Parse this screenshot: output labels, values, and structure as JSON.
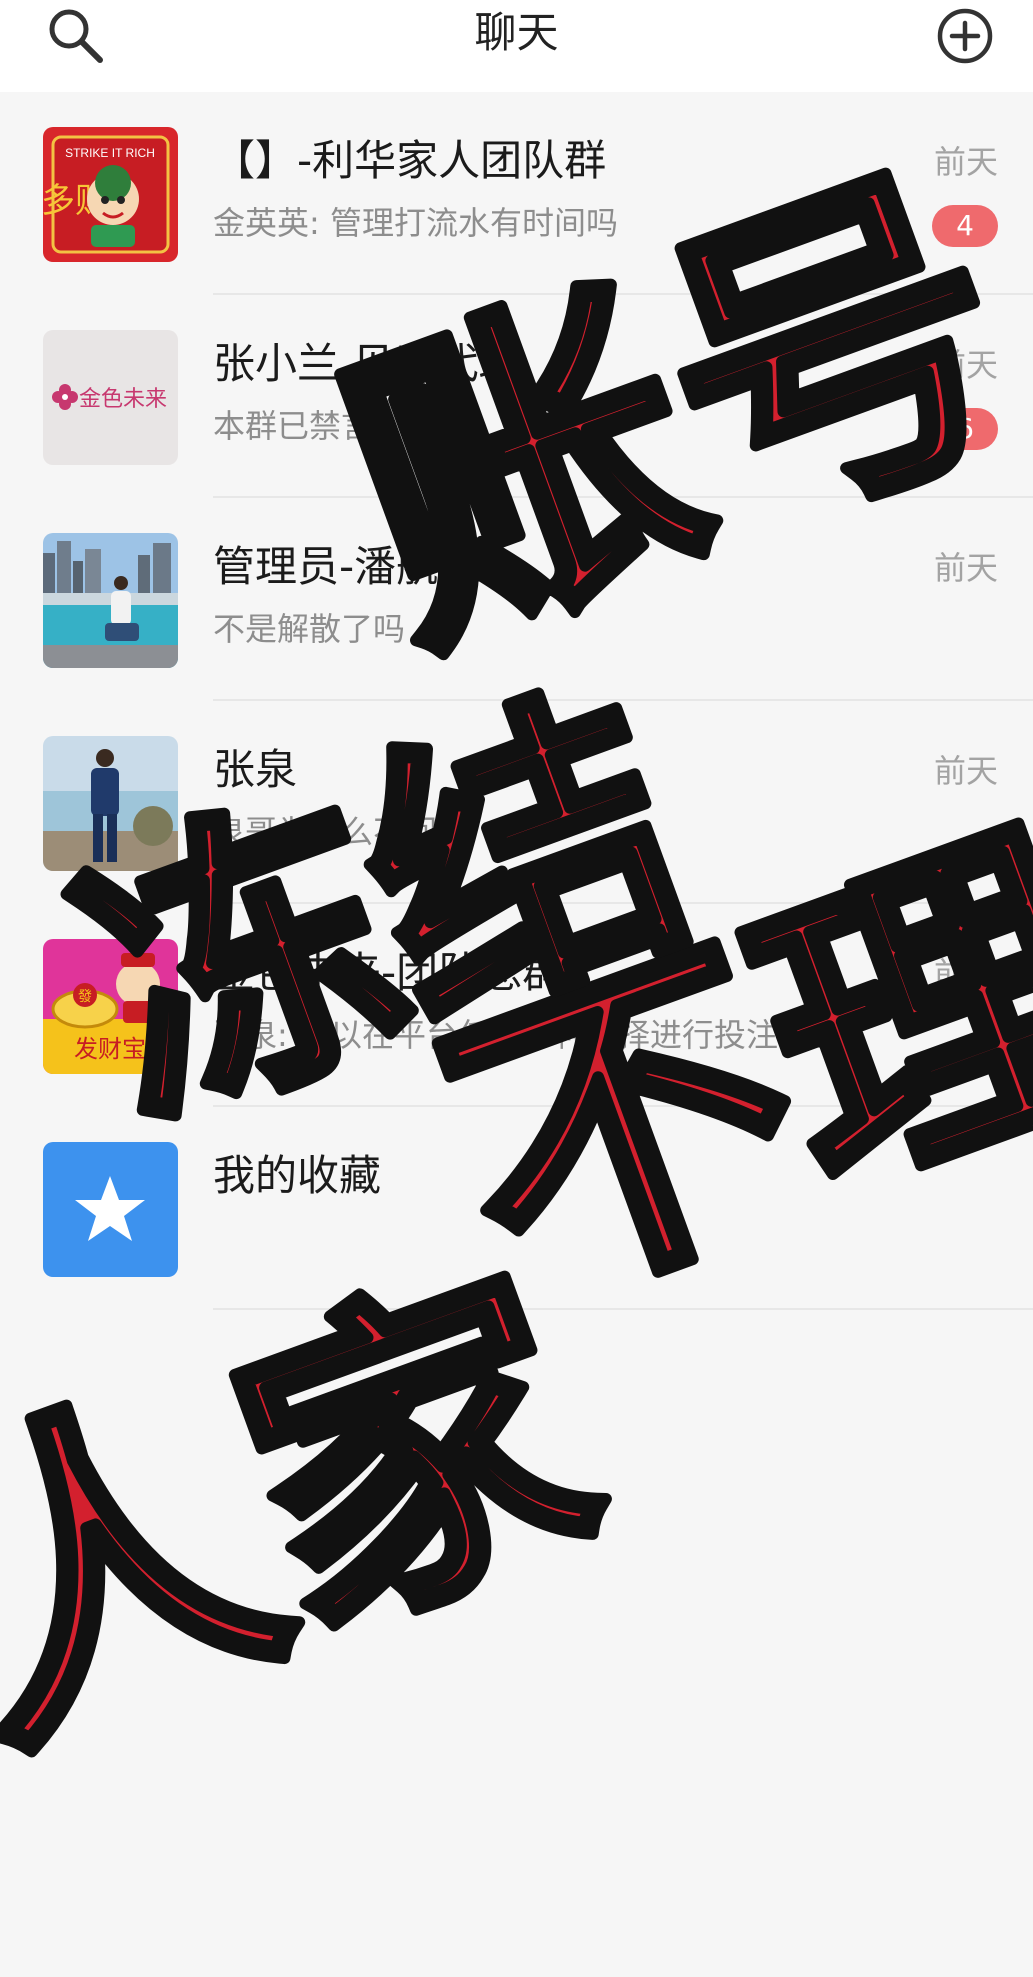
{
  "header": {
    "title": "聊天",
    "left_icon": "search-icon",
    "right_icon": "add-circle-icon"
  },
  "chats": [
    {
      "name": "【】-利华家人团队群",
      "preview": "金英英: 管理打流水有时间吗",
      "time": "前天",
      "badge": "4",
      "avatar": "fortune-god-avatar",
      "avatar_text": [
        "STRIKE IT RICH",
        "多财"
      ]
    },
    {
      "name": "张小兰 见习代理",
      "preview": "本群已禁言",
      "time": "前天",
      "badge": "6",
      "avatar": "brand-logo-avatar",
      "avatar_text": [
        "金色未来"
      ]
    },
    {
      "name": "管理员-潘航",
      "preview": "不是解散了吗",
      "time": "前天",
      "badge": "",
      "avatar": "photo-avatar-waterfront"
    },
    {
      "name": "张泉",
      "preview": "泉哥为什么不回复",
      "time": "前天",
      "badge": "",
      "avatar": "photo-avatar-man-suit"
    },
    {
      "name": "金色未来-团队总群",
      "preview": "张泉: 可以在平台任意彩种选择进行投注",
      "time": "前天",
      "badge": "",
      "avatar": "treasure-avatar",
      "avatar_text": [
        "发财宝",
        "發"
      ]
    },
    {
      "name": "我的收藏",
      "preview": "",
      "time": "",
      "badge": "",
      "avatar": "star-icon"
    }
  ],
  "overlay": {
    "text": [
      "账号",
      "不理",
      "冻结",
      "人家"
    ],
    "fill_color": "#d3202e",
    "stroke_color": "#111111"
  },
  "colors": {
    "badge": "#ef6a6d",
    "time": "#a3a3a3",
    "preview": "#8d8d8d",
    "background": "#f6f6f6"
  }
}
